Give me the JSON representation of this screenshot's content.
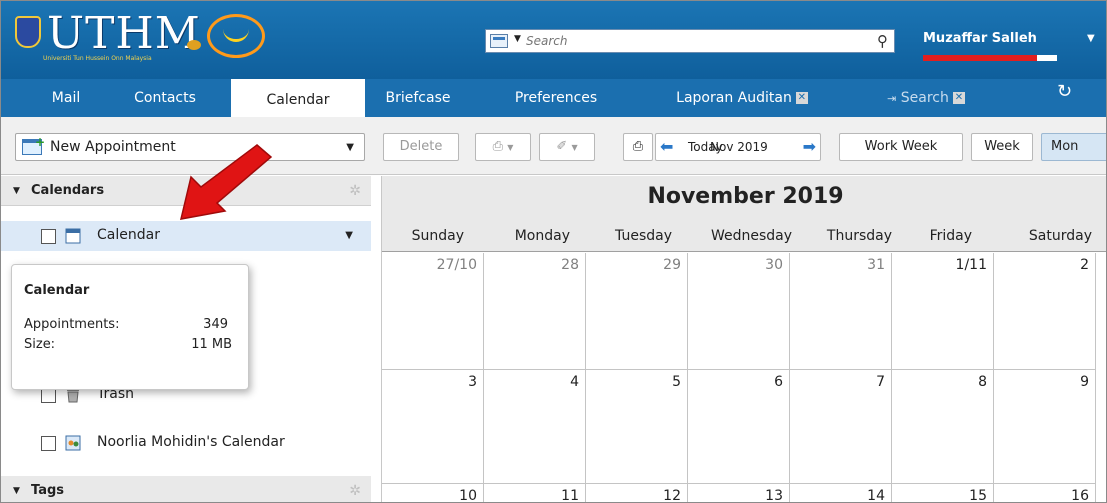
{
  "header": {
    "logo_text": "UTHM",
    "logo_subtitle": "Universiti Tun Hussein Onn Malaysia",
    "search": {
      "placeholder": "Search"
    },
    "user": {
      "name": "Muzaffar Salleh",
      "quota_fraction": 0.85
    },
    "colors": {
      "brand": "#1b6faf",
      "quota": "#e31e1e"
    }
  },
  "tabs": [
    {
      "label": "Mail"
    },
    {
      "label": "Contacts"
    },
    {
      "label": "Calendar"
    },
    {
      "label": "Briefcase"
    },
    {
      "label": "Preferences"
    },
    {
      "label": "Laporan Auditan"
    },
    {
      "label": "Search"
    }
  ],
  "toolbar": {
    "new_appointment": "New Appointment",
    "delete": "Delete",
    "today": "Today",
    "current_period": "Nov 2019",
    "work_week": "Work Week",
    "week": "Week",
    "month": "Mon"
  },
  "sidebar": {
    "calendars_header": "Calendars",
    "tags_header": "Tags",
    "items": [
      {
        "label": "Calendar",
        "icon": "calendar-icon"
      },
      {
        "label": "Trash",
        "icon": "trash-icon"
      },
      {
        "label": "Noorlia Mohidin's Calendar",
        "icon": "shared-calendar-icon"
      }
    ],
    "tooltip": {
      "title": "Calendar",
      "appointments_label": "Appointments:",
      "appointments_value": "349",
      "size_label": "Size:",
      "size_value": "11 MB"
    }
  },
  "calendar": {
    "title": "November 2019",
    "days_of_week": [
      "Sunday",
      "Monday",
      "Tuesday",
      "Wednesday",
      "Thursday",
      "Friday",
      "Saturday"
    ],
    "weeks": [
      [
        "27/10",
        "28",
        "29",
        "30",
        "31",
        "1/11",
        "2"
      ],
      [
        "3",
        "4",
        "5",
        "6",
        "7",
        "8",
        "9"
      ],
      [
        "10",
        "11",
        "12",
        "13",
        "14",
        "15",
        "16"
      ]
    ]
  }
}
